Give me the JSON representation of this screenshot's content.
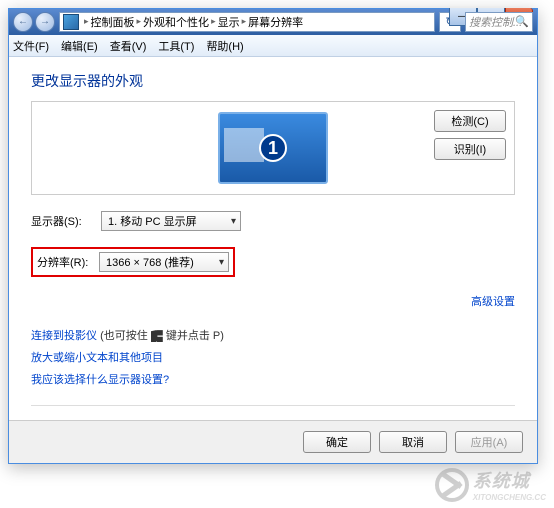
{
  "titlebar": {
    "breadcrumbs": [
      "控制面板",
      "外观和个性化",
      "显示",
      "屏幕分辨率"
    ],
    "search_placeholder": "搜索控制...",
    "win_min": "—",
    "win_max": "▢",
    "win_close": "✕",
    "nav_back": "←",
    "nav_fwd": "→",
    "refresh": "↻"
  },
  "menubar": {
    "file": "文件(F)",
    "edit": "编辑(E)",
    "view": "查看(V)",
    "tools": "工具(T)",
    "help": "帮助(H)"
  },
  "content": {
    "heading": "更改显示器的外观",
    "detect_btn": "检测(C)",
    "identify_btn": "识别(I)",
    "monitor_num": "1",
    "display_label": "显示器(S):",
    "display_value": "1. 移动 PC 显示屏",
    "resolution_label": "分辨率(R):",
    "resolution_value": "1366 × 768 (推荐)",
    "advanced_link": "高级设置",
    "projector_link": "连接到投影仪",
    "projector_hint": " (也可按住 ",
    "projector_hint2": " 键并点击 P)",
    "textsize_link": "放大或缩小文本和其他项目",
    "which_display_link": "我应该选择什么显示器设置?"
  },
  "footer": {
    "ok": "确定",
    "cancel": "取消",
    "apply": "应用(A)"
  },
  "watermark": {
    "text": "系统城",
    "sub": "XITONGCHENG.CC"
  }
}
